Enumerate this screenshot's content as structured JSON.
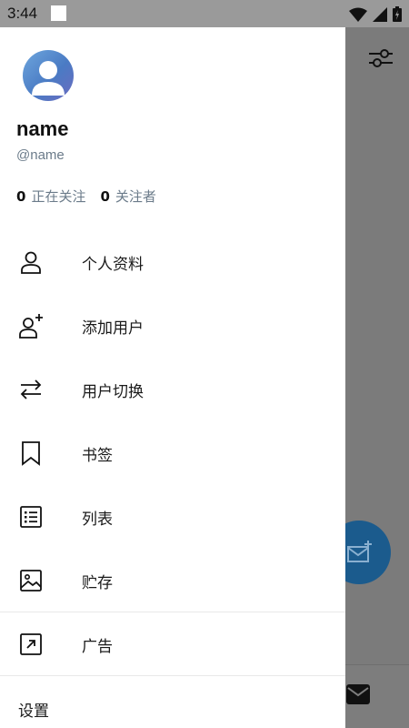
{
  "status_bar": {
    "time": "3:44"
  },
  "profile": {
    "name": "name",
    "handle": "@name",
    "following_count": "0",
    "following_label": "正在关注",
    "followers_count": "0",
    "followers_label": "关注者"
  },
  "menu": [
    {
      "label": "个人资料",
      "icon": "person-icon"
    },
    {
      "label": "添加用户",
      "icon": "add-user-icon"
    },
    {
      "label": "用户切换",
      "icon": "switch-arrows-icon"
    },
    {
      "label": "书签",
      "icon": "bookmark-icon"
    },
    {
      "label": "列表",
      "icon": "list-icon"
    },
    {
      "label": "贮存",
      "icon": "image-icon"
    },
    {
      "label": "广告",
      "icon": "external-arrow-icon"
    }
  ],
  "settings_label": "设置",
  "colors": {
    "fab": "#1b5b8d",
    "muted_text": "#6b7b8a",
    "scrim": "#7b7b7b"
  }
}
